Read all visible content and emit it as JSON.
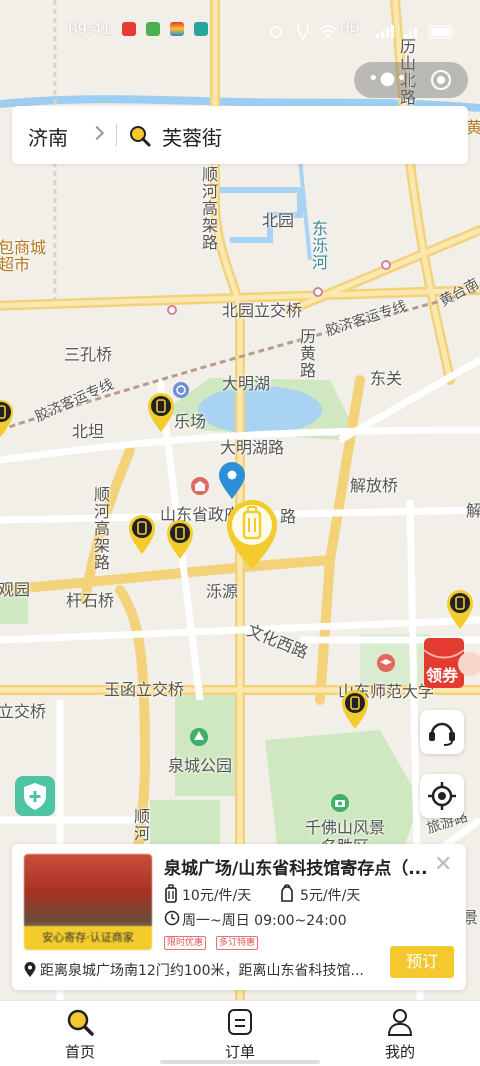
{
  "status_bar": {
    "time": "09:41",
    "network": "HD"
  },
  "search": {
    "city": "济南",
    "query": "芙蓉街"
  },
  "map_labels": {
    "lishan_road": "历山北路",
    "huang": "黄",
    "baoshan": "包商城",
    "shi": "超市",
    "shunhe_elevated": "顺河高架路",
    "beiyuan": "北园",
    "dongluohe": "东泺河",
    "beiyuan_interchange": "北园立交桥",
    "jiaoji_railway": "胶济客运专线",
    "jiaoji_railway_2": "胶济客运专线",
    "huangtai": "黄台南",
    "sankongqiao": "三孔桥",
    "lihuang": "历黄路",
    "daminghu": "大明湖",
    "dongguan": "东关",
    "letian": "乐场",
    "beitan": "北坦",
    "daminghu_road": "大明湖路",
    "jiefangqiao": "解放桥",
    "shunhe_2": "顺河高架路",
    "gov": "山东省政府",
    "xie": "解",
    "guan": "观园",
    "qianshiqiao": "杆石桥",
    "luoyuan": "泺源",
    "wenhua": "文化西路",
    "yuhan": "玉函立交桥",
    "jiaoqiao": "立交桥",
    "shida": "山东师范大学",
    "quancheng_park": "泉城公园",
    "qianfo": "千佛山风景名胜区",
    "lvyou": "旅游路",
    "jing": "景",
    "shunhe_3": "顺河"
  },
  "coupon_label": "领券",
  "card": {
    "badge": "安心寄存·认证商家",
    "title": "泉城广场/山东省科技馆寄存点（...",
    "price_luggage": "10元/件/天",
    "price_bag": "5元/件/天",
    "hours": "周一~周日 09:00~24:00",
    "tags": [
      "限时优惠",
      "多订特惠"
    ],
    "distance": "距离泉城广场南12门约100米，距离山东省科技馆...",
    "book_label": "预订"
  },
  "tabs": [
    {
      "label": "首页"
    },
    {
      "label": "订单"
    },
    {
      "label": "我的"
    }
  ],
  "colors": {
    "accent": "#f5c82e",
    "pin_blue": "#2d8fd5",
    "shield": "#4ec4a2",
    "coupon": "#e33b30"
  }
}
